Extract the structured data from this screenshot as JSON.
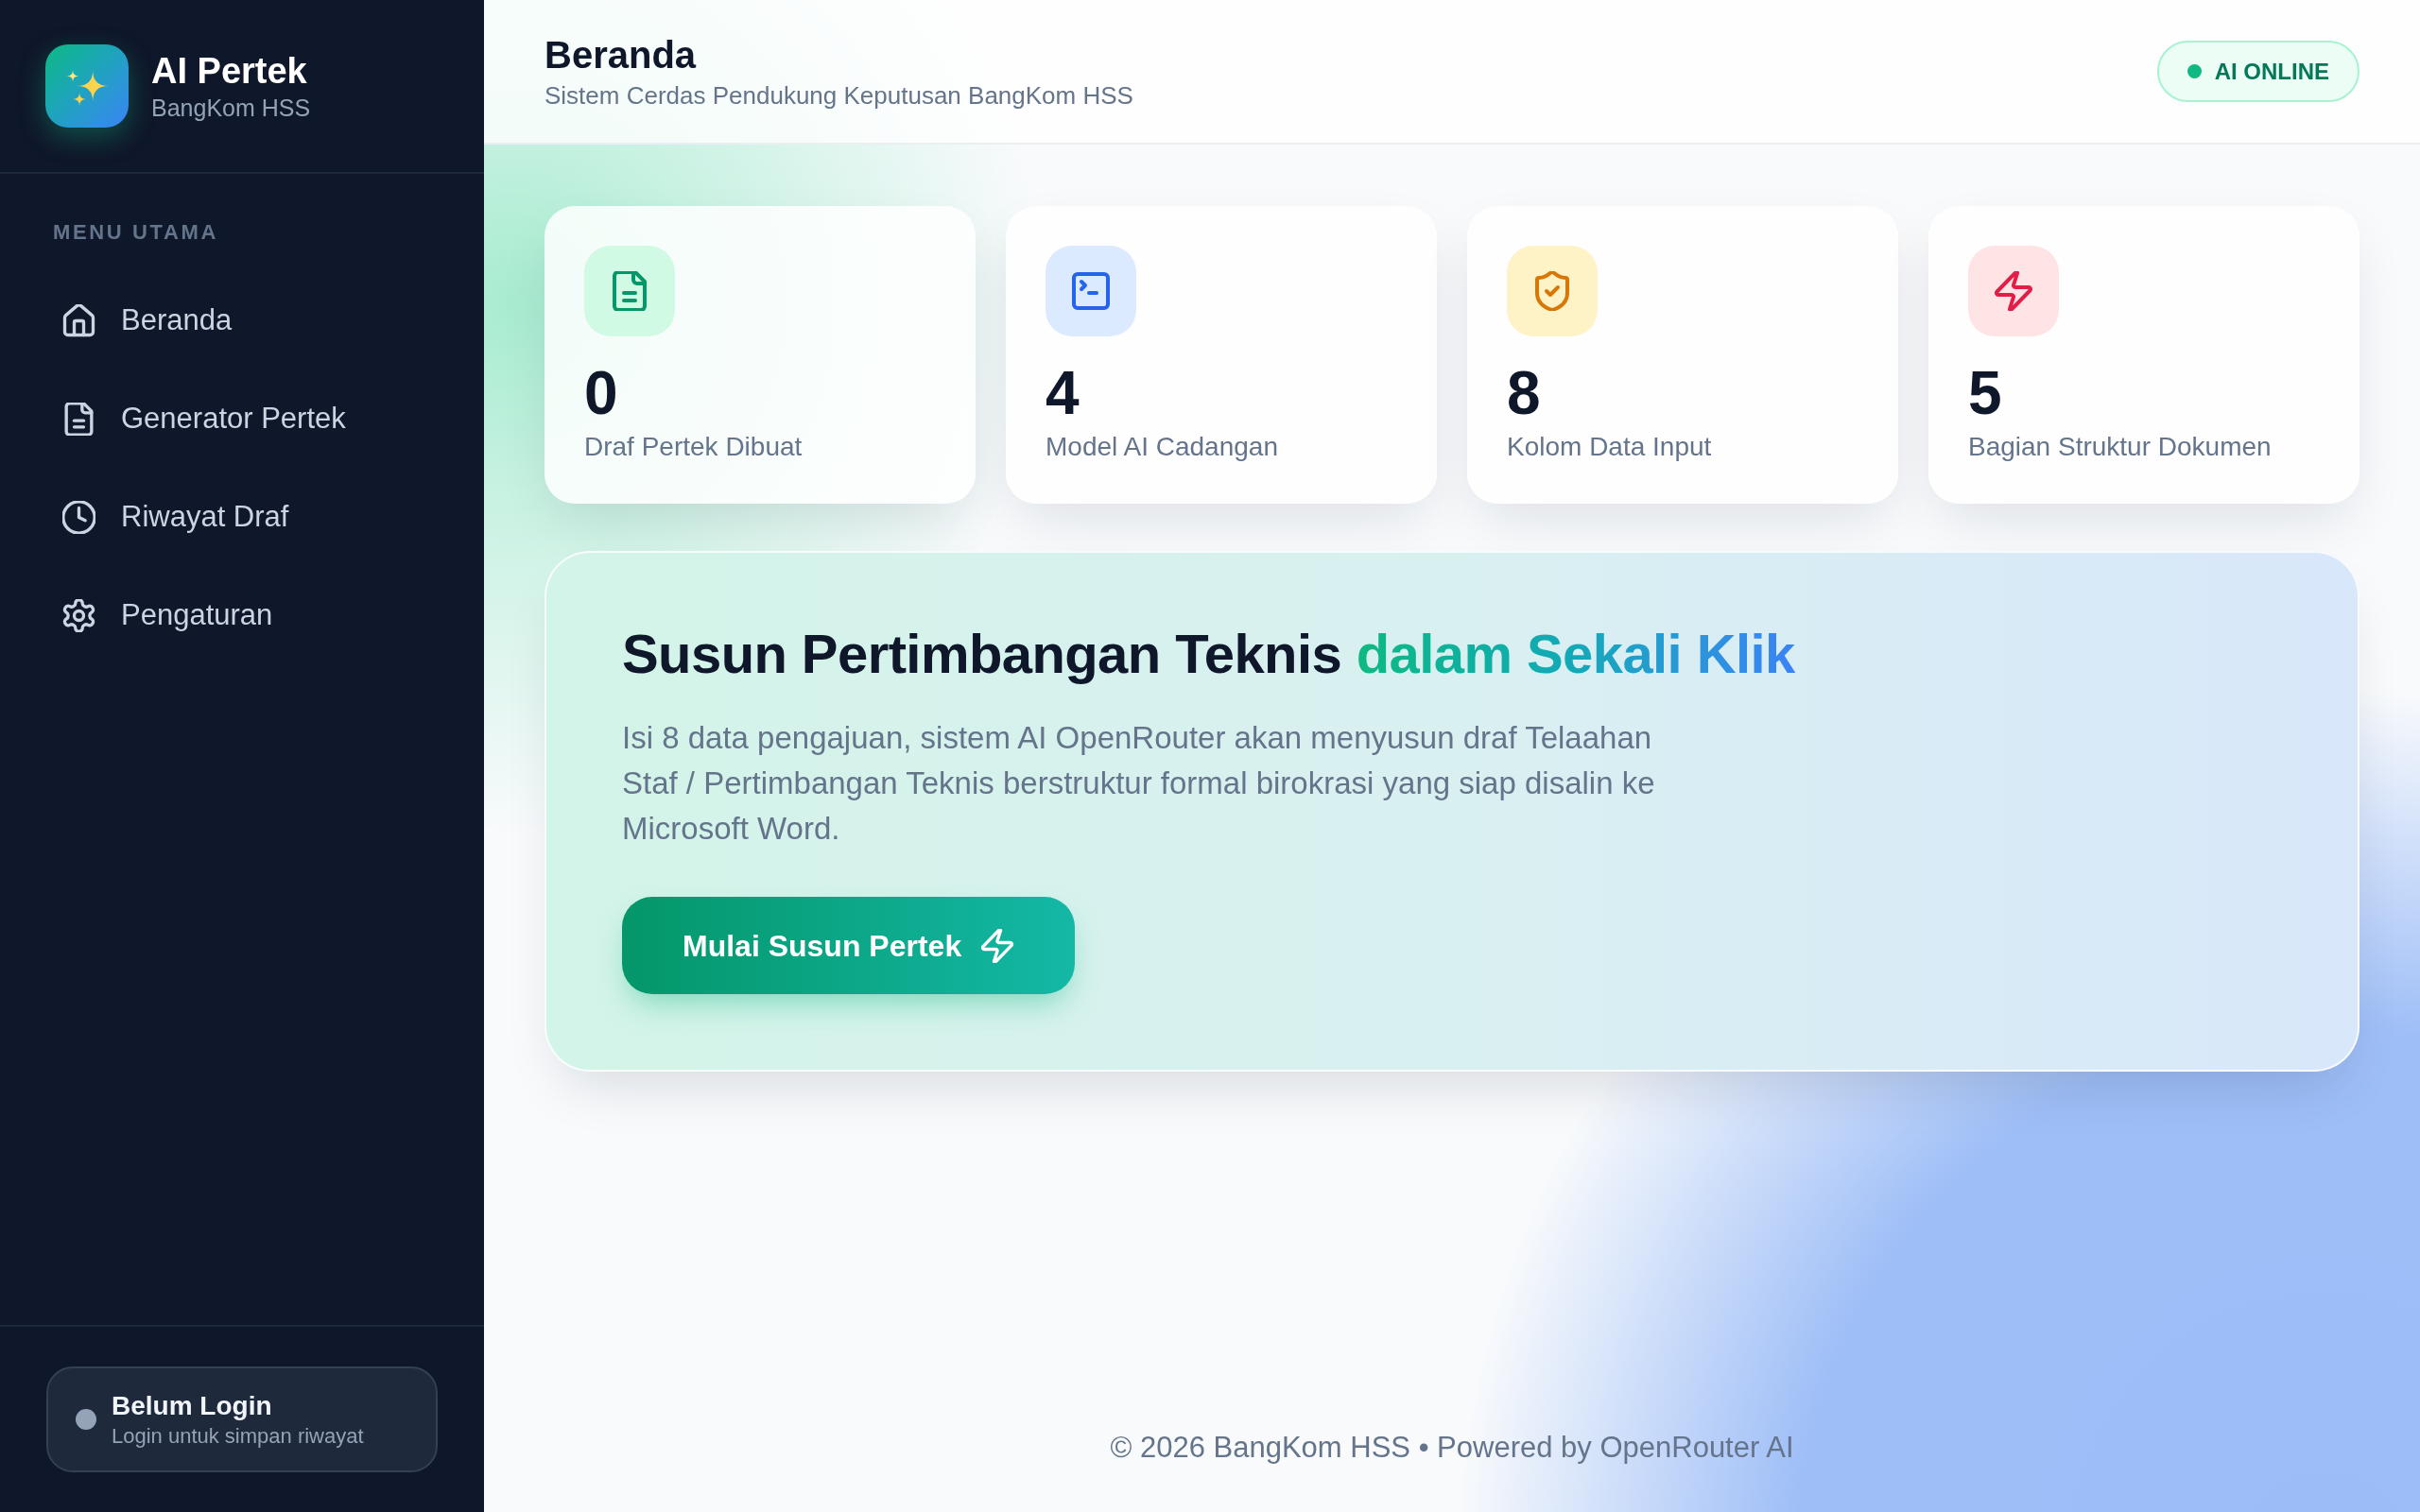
{
  "sidebar": {
    "logo": {
      "title": "AI Pertek",
      "subtitle": "BangKom HSS"
    },
    "section_label": "MENU UTAMA",
    "items": [
      {
        "label": "Beranda",
        "selected": false
      },
      {
        "label": "Generator Pertek",
        "selected": false
      },
      {
        "label": "Riwayat Draf",
        "selected": false
      },
      {
        "label": "Pengaturan",
        "selected": false
      }
    ],
    "user": {
      "title": "Belum Login",
      "subtitle": "Login untuk simpan riwayat",
      "logged_in": false
    }
  },
  "header": {
    "title": "Beranda",
    "subtitle": "Sistem Cerdas Pendukung Keputusan BangKom HSS",
    "status": {
      "label": "AI ONLINE",
      "online": true
    }
  },
  "stats": [
    {
      "value": "0",
      "label": "Draf Pertek Dibuat",
      "color": "#059669"
    },
    {
      "value": "4",
      "label": "Model AI Cadangan",
      "color": "#2563eb"
    },
    {
      "value": "8",
      "label": "Kolom Data Input",
      "color": "#d97706"
    },
    {
      "value": "5",
      "label": "Bagian Struktur Dokumen",
      "color": "#e11d48"
    }
  ],
  "hero": {
    "title": "Susun Pertimbangan Teknis",
    "title_highlight": "dalam Sekali Klik",
    "description": "Isi 8 data pengajuan, sistem AI OpenRouter akan menyusun draf Telaahan Staf / Pertimbangan Teknis berstruktur formal birokrasi yang siap disalin ke Microsoft Word.",
    "button": "Mulai Susun Pertek"
  },
  "footer": "© 2026 BangKom HSS • Powered by OpenRouter AI"
}
